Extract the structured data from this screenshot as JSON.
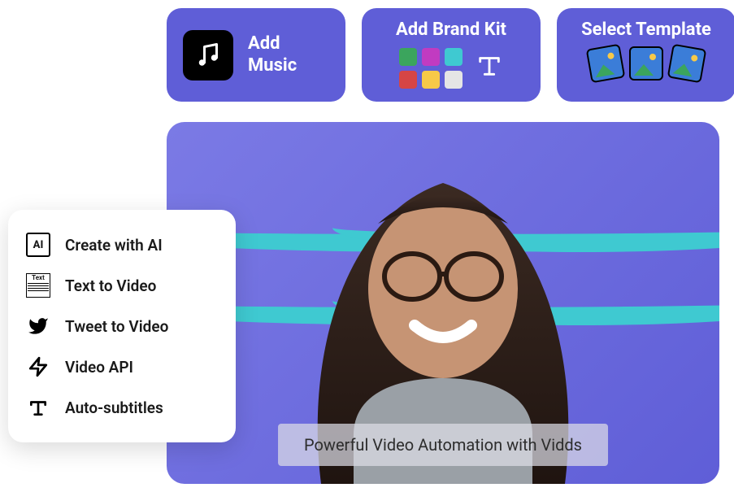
{
  "top_cards": {
    "music_label": "Add\nMusic",
    "brand_label": "Add Brand Kit",
    "template_label": "Select Template",
    "swatches": [
      "#3BA55D",
      "#C13BC1",
      "#3FC9D1",
      "#D64545",
      "#F7C948",
      "#E5E5E5"
    ]
  },
  "sidebar": {
    "items": [
      {
        "icon": "ai",
        "label": "Create with AI"
      },
      {
        "icon": "text",
        "label": "Text to Video"
      },
      {
        "icon": "tweet",
        "label": "Tweet to Video"
      },
      {
        "icon": "bolt",
        "label": "Video API"
      },
      {
        "icon": "type",
        "label": "Auto-subtitles"
      }
    ]
  },
  "hero": {
    "caption": "Powerful Video Automation with Vidds"
  }
}
